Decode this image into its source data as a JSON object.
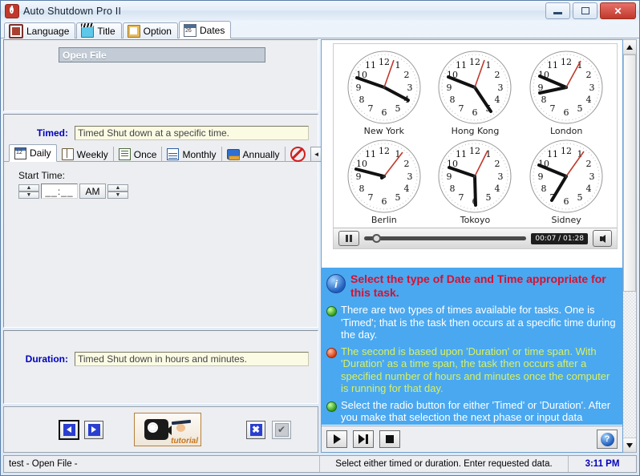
{
  "window": {
    "title": "Auto Shutdown Pro II",
    "app_icon": "power-icon",
    "buttons": {
      "minimize": "minimize-icon",
      "maximize": "maximize-icon",
      "close": "✕"
    }
  },
  "tabs": [
    {
      "label": "Language",
      "icon": "language-icon",
      "active": false
    },
    {
      "label": "Title",
      "icon": "clapperboard-icon",
      "active": false
    },
    {
      "label": "Option",
      "icon": "notepad-icon",
      "active": false
    },
    {
      "label": "Dates",
      "icon": "calendar-icon",
      "active": true
    }
  ],
  "left": {
    "open_file": {
      "label": "Open File"
    },
    "timed": {
      "label": "Timed:",
      "value": "Timed Shut down at a specific time."
    },
    "subtabs": [
      {
        "label": "Daily",
        "icon": "calendar-12-icon",
        "active": true
      },
      {
        "label": "Weekly",
        "icon": "book-icon",
        "active": false
      },
      {
        "label": "Once",
        "icon": "clipboard-icon",
        "active": false
      },
      {
        "label": "Monthly",
        "icon": "grid-calendar-icon",
        "active": false
      },
      {
        "label": "Annually",
        "icon": "books-icon",
        "active": false
      },
      {
        "label": "",
        "icon": "no-entry-icon",
        "active": false
      }
    ],
    "subtab_scroll": {
      "left": "◄",
      "right": "►"
    },
    "start_time": {
      "label": "Start Time:",
      "value": "__:__",
      "meridiem": "AM",
      "up": "▲",
      "down": "▼"
    },
    "duration": {
      "label": "Duration:",
      "value": "Timed Shut down in hours and minutes."
    },
    "actions": {
      "back": "back-arrow",
      "forward": "forward-arrow",
      "tutorial_label": "tutorial",
      "cancel": "✖",
      "confirm": "✔"
    }
  },
  "right": {
    "video": {
      "clocks": [
        {
          "city": "New York",
          "hour": 9.6,
          "minute": 20,
          "second": 7
        },
        {
          "city": "Hong Kong",
          "hour": 9.7,
          "minute": 26,
          "second": 7
        },
        {
          "city": "London",
          "hour": 9.45,
          "minute": 44,
          "second": 7
        },
        {
          "city": "Berlin",
          "hour": 9.9,
          "minute": 52,
          "second": 7
        },
        {
          "city": "Tokoyo",
          "hour": 9.5,
          "minute": 30,
          "second": 7
        },
        {
          "city": "Sidney",
          "hour": 10.0,
          "minute": 35,
          "second": 7
        }
      ],
      "timecode": "00:07 / 01:28",
      "pause": "pause-icon",
      "volume": "volume-icon",
      "seek_percent": 8
    },
    "help": {
      "title": "Select the type of Date and Time appropriate for this task.",
      "bullets": [
        {
          "dot": "green",
          "color": "white",
          "text": "There are two types of times available for tasks. One is 'Timed'; that is the task then occurs at a specific time during the day."
        },
        {
          "dot": "red",
          "color": "yellow",
          "text": "The second is based upon 'Duration' or time span. With 'Duration' as a time span, the task then occurs after a specified number of hours and minutes once the computer is running for that day."
        },
        {
          "dot": "green",
          "color": "white",
          "text": "Select the radio button for either 'Timed' or 'Duration'. After you make that selection the next phase or input data"
        }
      ]
    },
    "controls": {
      "play": "play-icon",
      "next": "skip-forward-icon",
      "stop": "stop-icon",
      "help": "?"
    }
  },
  "statusbar": {
    "left": "test - Open File -",
    "center": "Select either timed or duration. Enter requested data.",
    "time": "3:11 PM"
  }
}
